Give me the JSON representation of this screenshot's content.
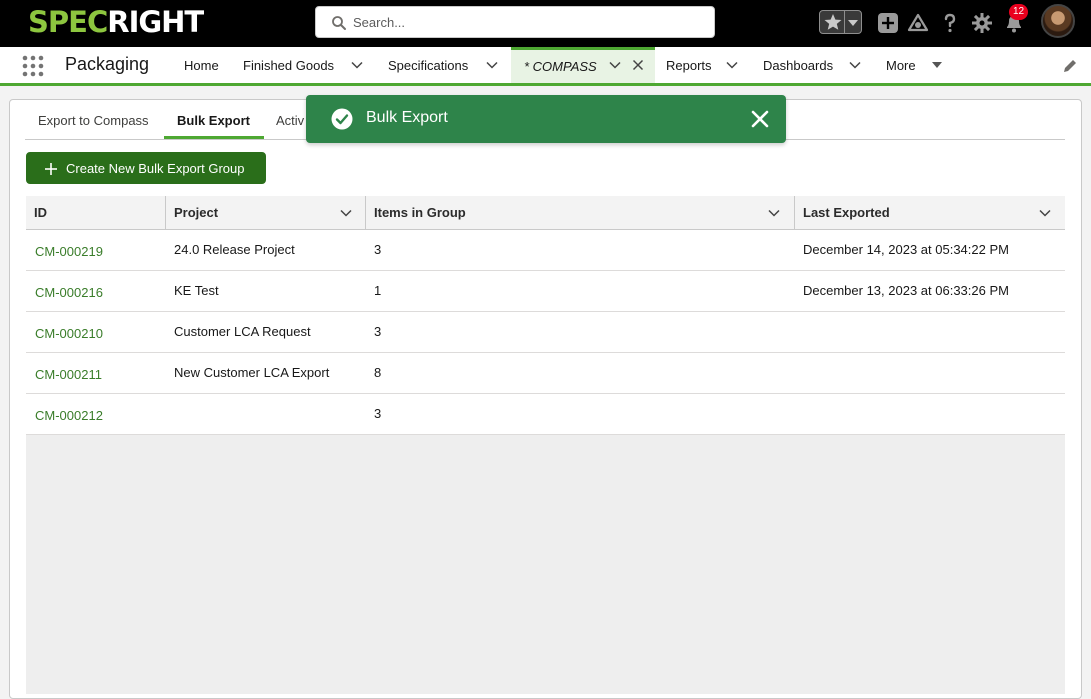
{
  "header": {
    "logo_text_a": "SPEC",
    "logo_text_b": "RIGHT",
    "search_placeholder": "Search...",
    "notification_count": "12",
    "icons": [
      "star-icon",
      "chevron-down-icon",
      "add-icon",
      "trailhead-icon",
      "help-icon",
      "gear-icon",
      "bell-icon",
      "avatar"
    ]
  },
  "nav": {
    "app_name": "Packaging",
    "items": [
      {
        "label": "Home"
      },
      {
        "label": "Finished Goods"
      },
      {
        "label": "Specifications"
      },
      {
        "label": "* COMPASS"
      },
      {
        "label": "Reports"
      },
      {
        "label": "Dashboards"
      },
      {
        "label": "More"
      }
    ]
  },
  "tabs": [
    {
      "label": "Export to Compass"
    },
    {
      "label": "Bulk Export"
    },
    {
      "label": "Activ"
    }
  ],
  "create_button": {
    "label": "Create New Bulk Export Group"
  },
  "table": {
    "columns": [
      "ID",
      "Project",
      "Items in Group",
      "Last Exported"
    ],
    "rows": [
      {
        "id": "CM-000219",
        "project": "24.0 Release Project",
        "items": "3",
        "last": "December 14, 2023 at 05:34:22 PM"
      },
      {
        "id": "CM-000216",
        "project": "KE Test",
        "items": "1",
        "last": "December 13, 2023 at 06:33:26 PM"
      },
      {
        "id": "CM-000210",
        "project": "Customer LCA Request",
        "items": "3",
        "last": ""
      },
      {
        "id": "CM-000211",
        "project": "New Customer LCA Export",
        "items": "8",
        "last": ""
      },
      {
        "id": "CM-000212",
        "project": "",
        "items": "3",
        "last": ""
      }
    ]
  },
  "toast": {
    "message": "Bulk Export"
  },
  "colors": {
    "brand_green": "#8dc63f",
    "accent_green": "#4ea832",
    "button_green": "#2a6e1a",
    "toast_green": "#2e844a",
    "link_green": "#3a7d2a"
  }
}
